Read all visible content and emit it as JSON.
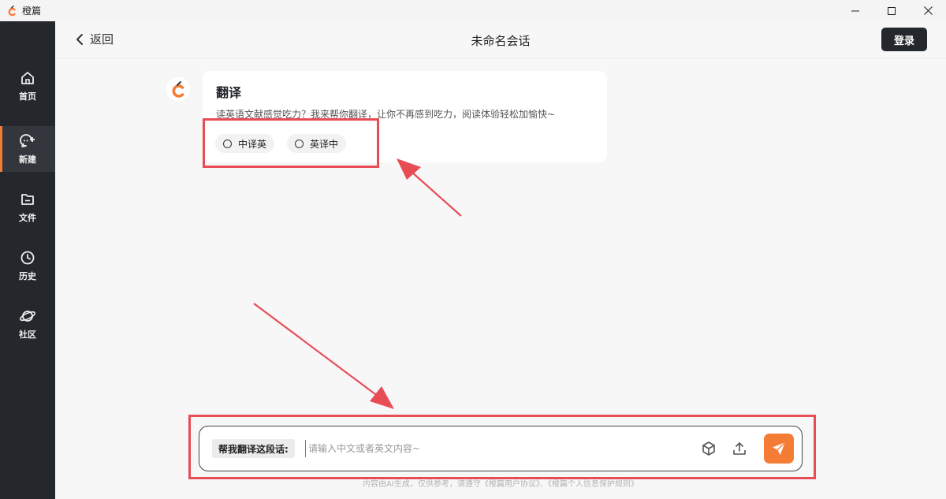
{
  "window": {
    "title": "橙篇"
  },
  "sidebar": {
    "items": [
      {
        "label": "首页",
        "icon": "home-icon"
      },
      {
        "label": "新建",
        "icon": "new-chat-icon",
        "active": true
      },
      {
        "label": "文件",
        "icon": "folder-icon"
      },
      {
        "label": "历史",
        "icon": "clock-icon"
      },
      {
        "label": "社区",
        "icon": "planet-icon"
      }
    ]
  },
  "header": {
    "back_label": "返回",
    "title": "未命名会话",
    "login_label": "登录"
  },
  "message": {
    "title": "翻译",
    "description": "读英语文献感觉吃力？我来帮你翻译，让你不再感到吃力，阅读体验轻松加愉快~",
    "options": [
      "中译英",
      "英译中"
    ]
  },
  "composer": {
    "prompt_tag": "帮我翻译这段话:",
    "placeholder": "请输入中文或者英文内容~",
    "value": ""
  },
  "footer": {
    "disclaimer": "内容由AI生成，仅供参考，请遵守《橙篇用户协议》、《橙篇个人信息保护规则》"
  },
  "colors": {
    "accent": "#f47c35",
    "sidebar_bg": "#24272c",
    "highlight": "#e84c55"
  }
}
